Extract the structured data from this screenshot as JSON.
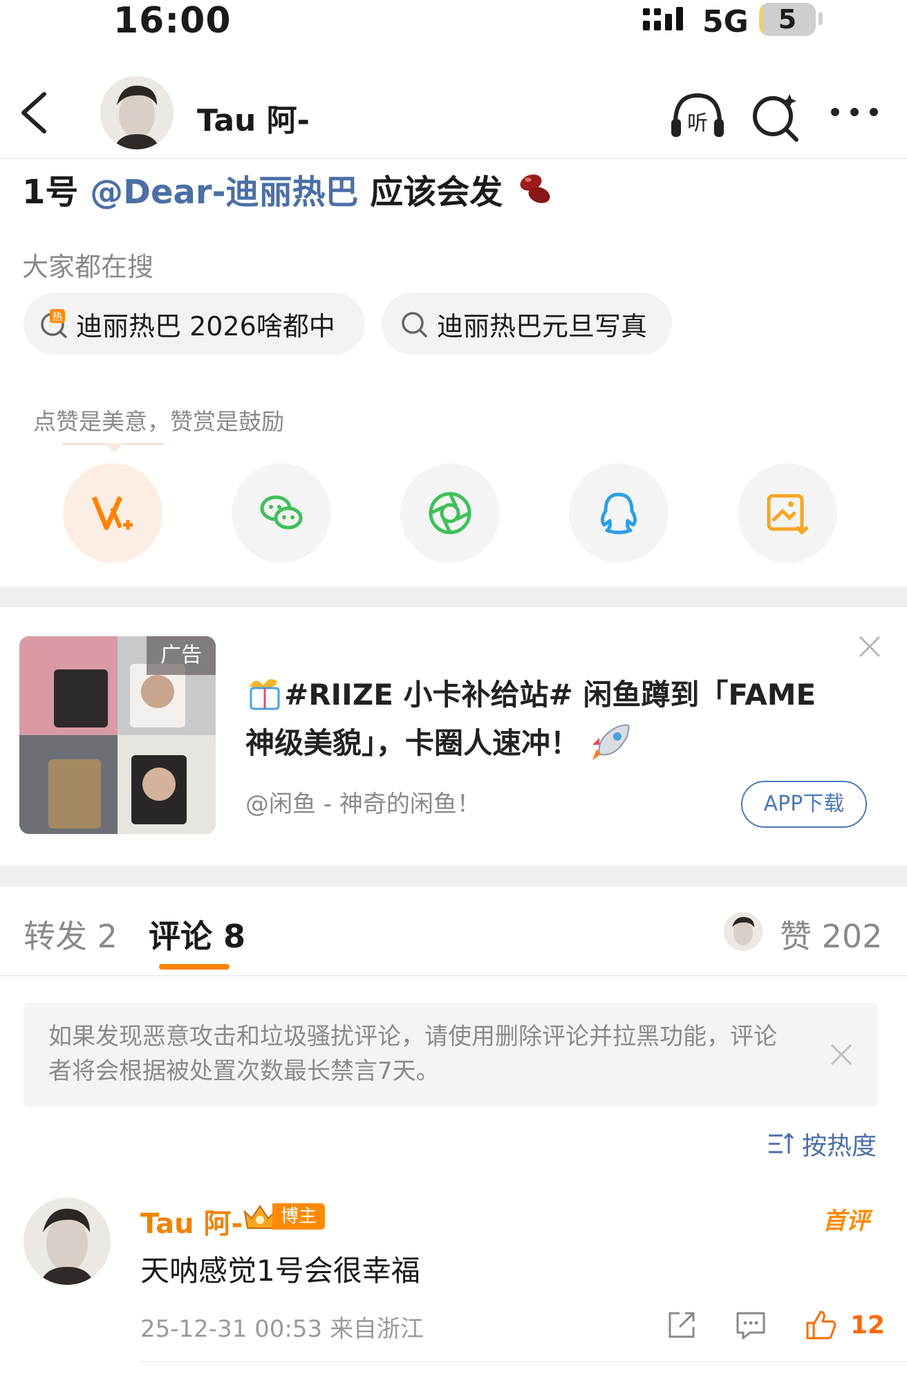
{
  "status_bar": {
    "time": "16:00",
    "network": "5G",
    "battery_level": "5",
    "battery_fraction": 0.05
  },
  "header": {
    "username": "Tau 阿-"
  },
  "post": {
    "prefix": "1号 ",
    "mention": "@Dear-迪丽热巴",
    "suffix": " 应该会发",
    "emoji": "beans-emoji"
  },
  "search": {
    "title": "大家都在搜",
    "chips": [
      {
        "label": "迪丽热巴 2026啥都中",
        "icon": "hot-search-icon"
      },
      {
        "label": "迪丽热巴元旦写真",
        "icon": "search-icon"
      }
    ]
  },
  "reward": {
    "tip": "点赞是美意，赞赏是鼓励"
  },
  "share_icons": [
    "v-plus-icon",
    "wechat-icon",
    "moments-icon",
    "qq-icon",
    "save-image-icon"
  ],
  "ad": {
    "tag": "广告",
    "title": "#RIIZE 小卡补给站# 闲鱼蹲到「FAME 神级美貌」，卡圈人速冲！",
    "source": "@闲鱼 - 神奇的闲鱼！",
    "button": "APP下载"
  },
  "tabs": {
    "repost": "转发 2",
    "comments": "评论 8",
    "likes": "赞 202"
  },
  "notice": {
    "text": "如果发现恶意攻击和垃圾骚扰评论，请使用删除评论并拉黑功能，评论者将会根据被处置次数最长禁言7天。"
  },
  "sort": {
    "label": "按热度"
  },
  "comment": {
    "author": "Tau 阿-",
    "badge": "博主",
    "first_tag": "首评",
    "text": "天呐感觉1号会很幸福",
    "time": "25-12-31 00:53",
    "location": "来自浙江",
    "likes": "12"
  },
  "colors": {
    "accent": "#ff8200",
    "link": "#4b6fa6",
    "like": "#ff6a00"
  }
}
